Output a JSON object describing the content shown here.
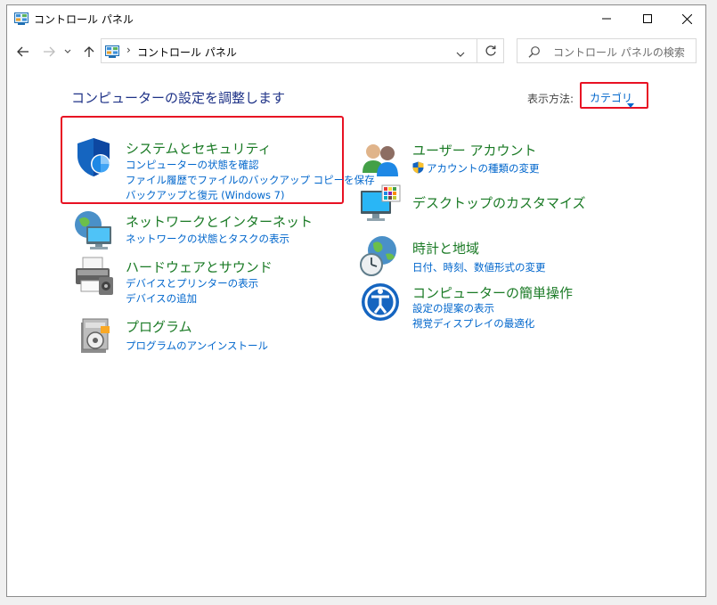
{
  "window": {
    "title": "コントロール パネル"
  },
  "address": {
    "sep": "›",
    "path": "コントロール パネル"
  },
  "search": {
    "placeholder": "コントロール パネルの検索"
  },
  "main": {
    "heading": "コンピューターの設定を調整します",
    "view_by_label": "表示方法:",
    "view_by_value": "カテゴリ"
  },
  "categories": {
    "system": {
      "title": "システムとセキュリティ",
      "links": [
        "コンピューターの状態を確認",
        "ファイル履歴でファイルのバックアップ コピーを保存",
        "バックアップと復元 (Windows 7)"
      ]
    },
    "network": {
      "title": "ネットワークとインターネット",
      "links": [
        "ネットワークの状態とタスクの表示"
      ]
    },
    "hardware": {
      "title": "ハードウェアとサウンド",
      "links": [
        "デバイスとプリンターの表示",
        "デバイスの追加"
      ]
    },
    "programs": {
      "title": "プログラム",
      "links": [
        "プログラムのアンインストール"
      ]
    },
    "users": {
      "title": "ユーザー アカウント",
      "links": [
        "アカウントの種類の変更"
      ]
    },
    "desktop": {
      "title": "デスクトップのカスタマイズ",
      "links": []
    },
    "clock": {
      "title": "時計と地域",
      "links": [
        "日付、時刻、数値形式の変更"
      ]
    },
    "ease": {
      "title": "コンピューターの簡単操作",
      "links": [
        "設定の提案の表示",
        "視覚ディスプレイの最適化"
      ]
    }
  },
  "colors": {
    "heading": "#1e3287",
    "category_title": "#1a7a25",
    "link": "#0066cc",
    "highlight": "#e81123"
  }
}
